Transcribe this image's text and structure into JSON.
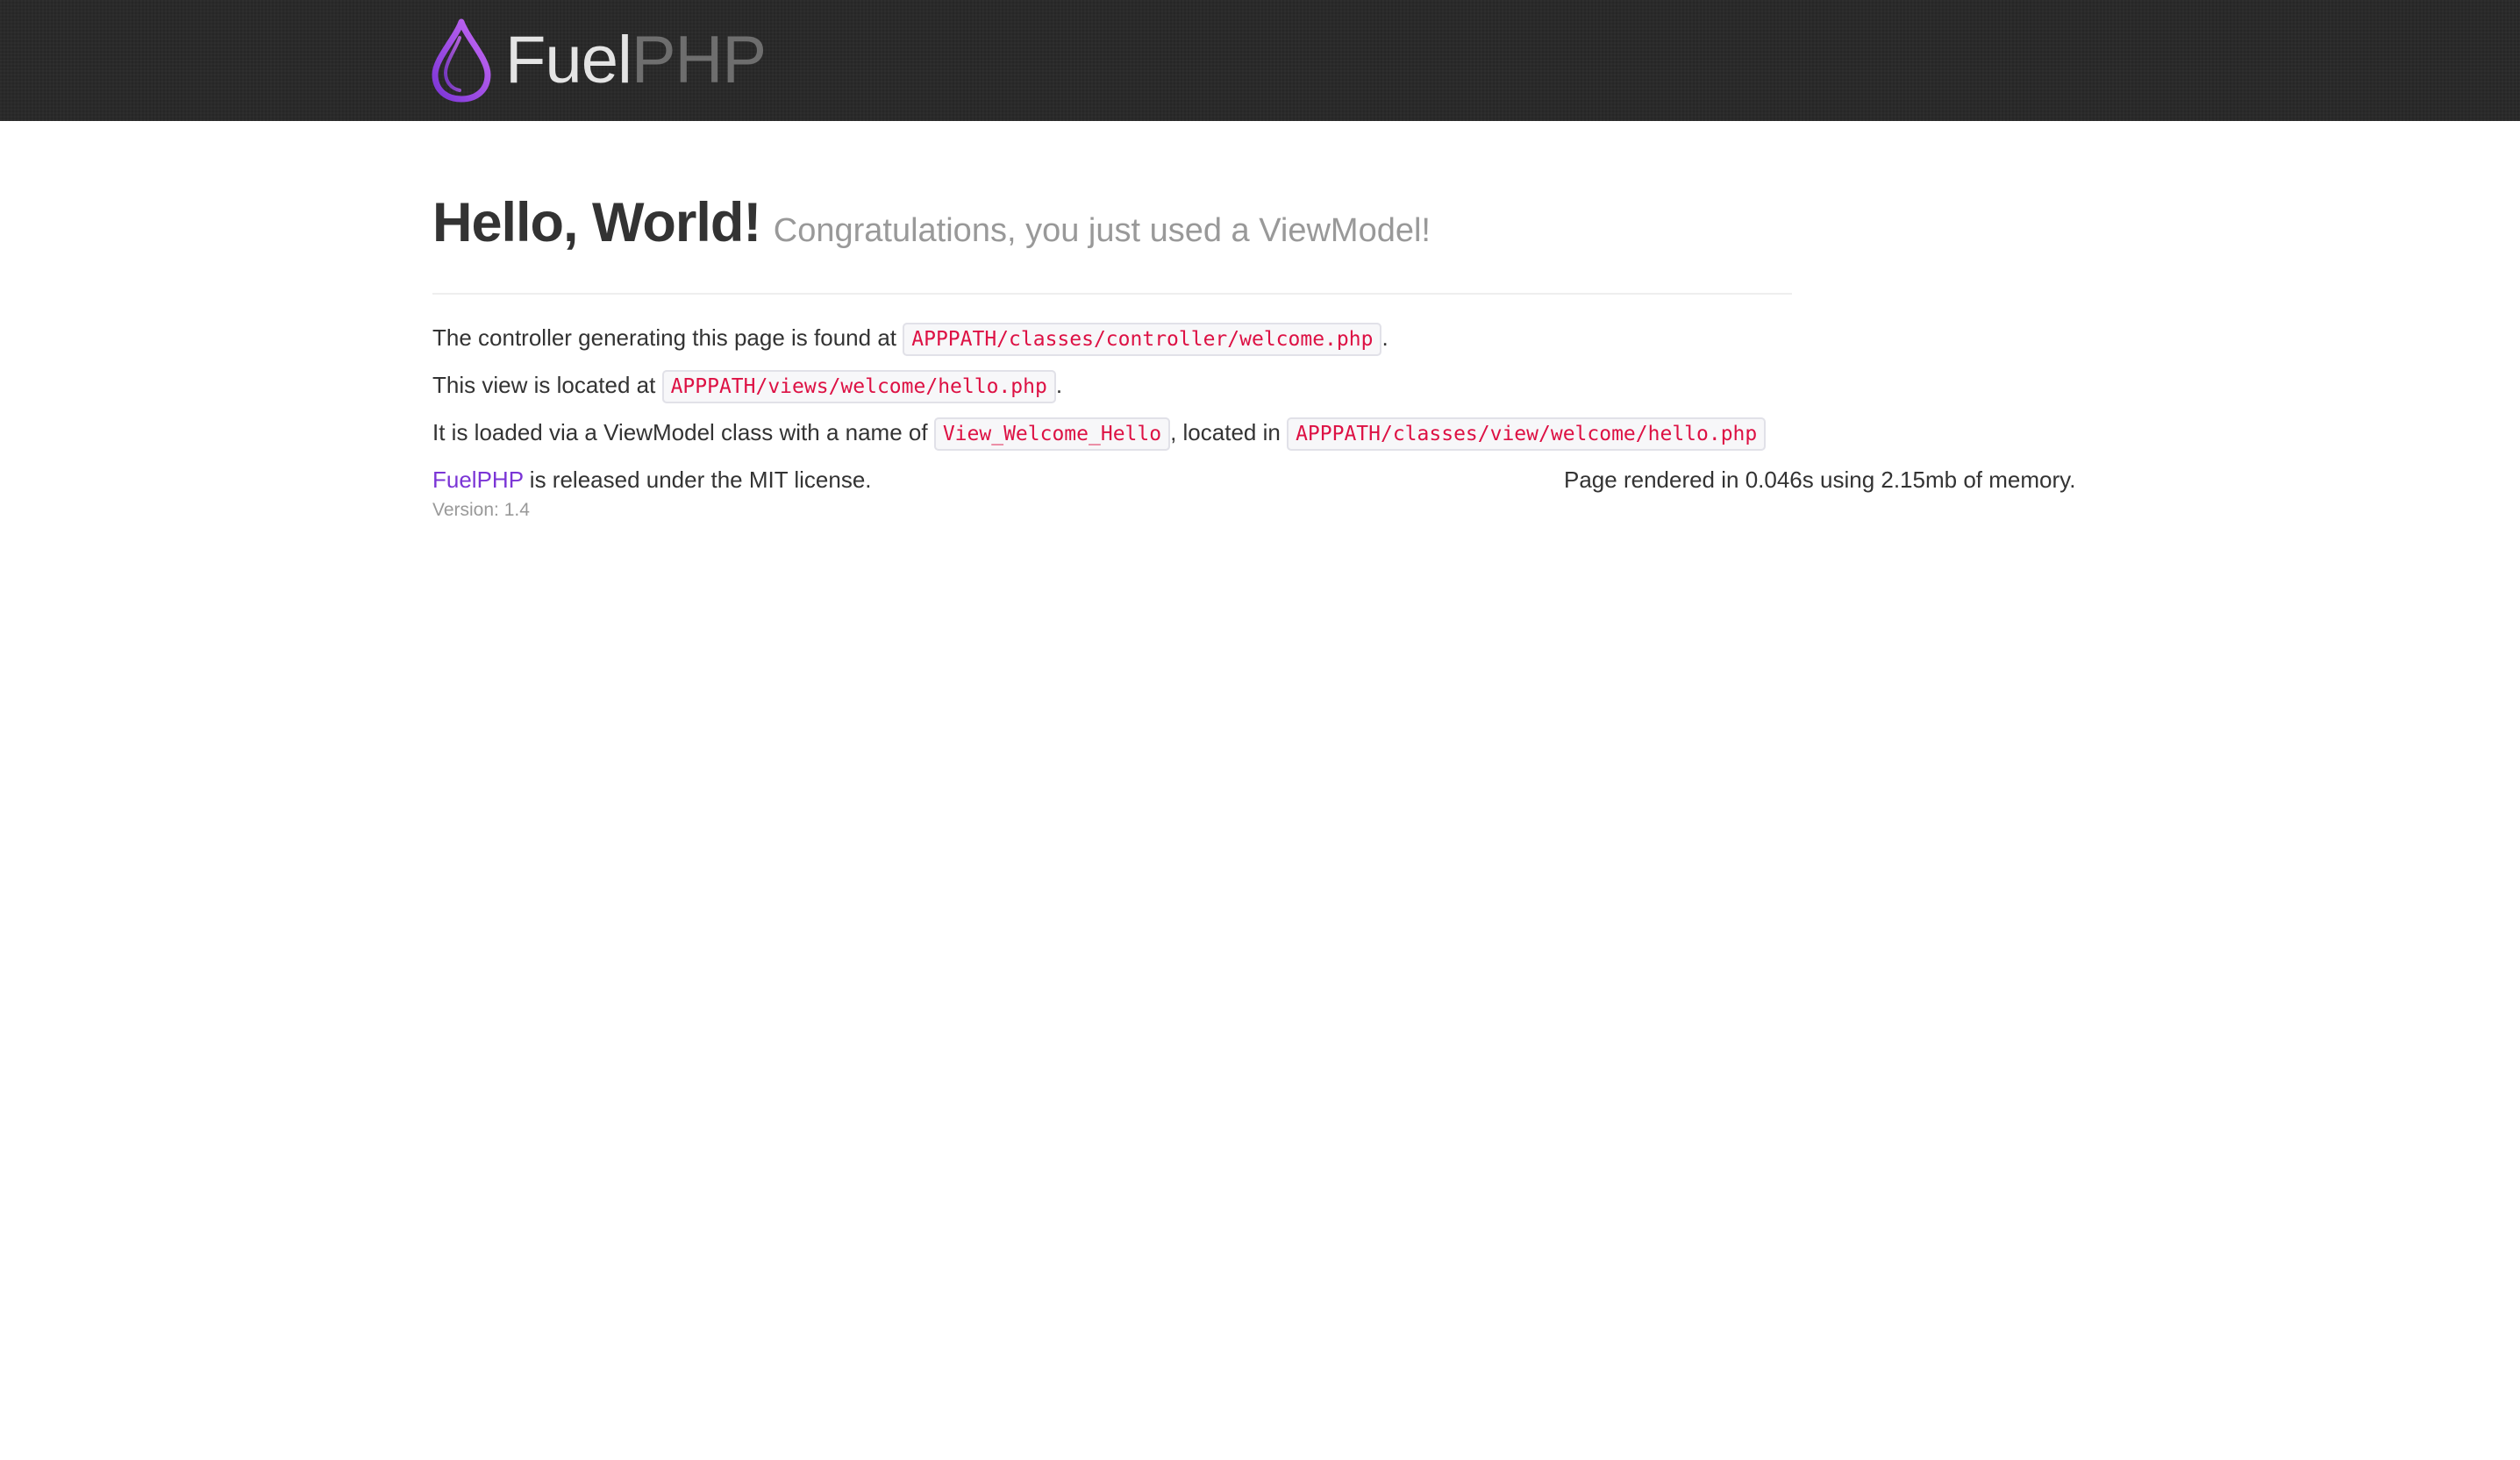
{
  "header": {
    "brand_fuel": "Fuel",
    "brand_php": "PHP",
    "bar_color": "#262626",
    "logo_gradient": [
      "#7b35d6",
      "#c86bf5"
    ]
  },
  "hero": {
    "title": "Hello, World!",
    "subtitle": "Congratulations, you just used a ViewModel!"
  },
  "info": {
    "controller_text": "The controller generating this page is found at",
    "controller_path": "APPPATH/classes/controller/welcome.php",
    "controller_end": ".",
    "view_text": "This view is located at",
    "view_path": "APPPATH/views/welcome/hello.php",
    "view_end": ".",
    "viewmodel_text": "It is loaded via a ViewModel class with a name of",
    "viewmodel_class": "View_Welcome_Hello",
    "viewmodel_mid": ", located in",
    "viewmodel_path": "APPPATH/classes/view/welcome/hello.php"
  },
  "footer": {
    "link": "FuelPHP",
    "license_text": " is released under the MIT license.",
    "render_stats": "Page rendered in 0.046s using 2.15mb of memory.",
    "version": "Version: 1.4"
  },
  "colors": {
    "code_text": "#dd1144",
    "link": "#7b35d6",
    "muted": "#999999"
  }
}
